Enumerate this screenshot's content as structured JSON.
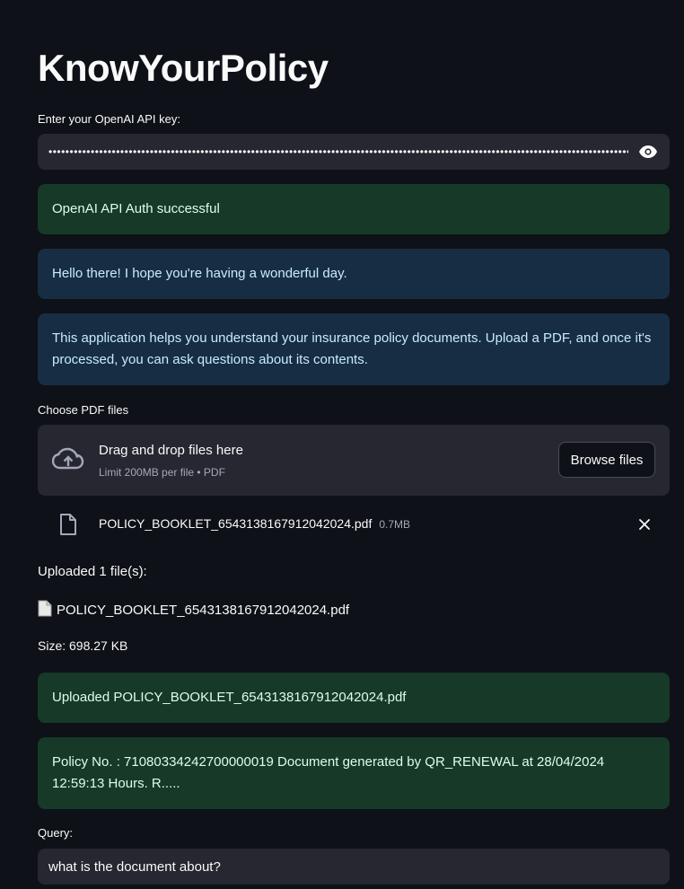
{
  "app": {
    "title": "KnowYourPolicy"
  },
  "api_key": {
    "label": "Enter your OpenAI API key:",
    "value": "••••••••••••••••••••••••••••••••••••••••••••••••••••••••••••••••••••••••••••••••••••••••••••••••••••••••••••••••••••••••••••••••••••••••••••••••••••••••••••••••••••••"
  },
  "alerts": {
    "auth_success": "OpenAI API Auth successful",
    "greeting": "Hello there! I hope you're having a wonderful day.",
    "app_info": "This application helps you understand your insurance policy documents. Upload a PDF, and once it's processed, you can ask questions about its contents."
  },
  "uploader": {
    "label": "Choose PDF files",
    "drop_title": "Drag and drop files here",
    "drop_sub": "Limit 200MB per file • PDF",
    "browse_label": "Browse files",
    "file_name": "POLICY_BOOKLET_6543138167912042024.pdf",
    "file_size": "0.7MB"
  },
  "summary": {
    "uploaded_count": "Uploaded 1 file(s):",
    "file_name": "POLICY_BOOKLET_6543138167912042024.pdf",
    "size": "Size: 698.27 KB"
  },
  "status": {
    "uploaded": "Uploaded POLICY_BOOKLET_6543138167912042024.pdf",
    "preview": "Policy No. : 71080334242700000019 Document generated by QR_RENEWAL at 28/04/2024 12:59:13 Hours. R....."
  },
  "query": {
    "label": "Query:",
    "value": "what is the document about?"
  },
  "colors": {
    "background": "#0e1117",
    "input_bg": "#262730",
    "success_bg": "#173928",
    "info_bg": "#172d43"
  }
}
